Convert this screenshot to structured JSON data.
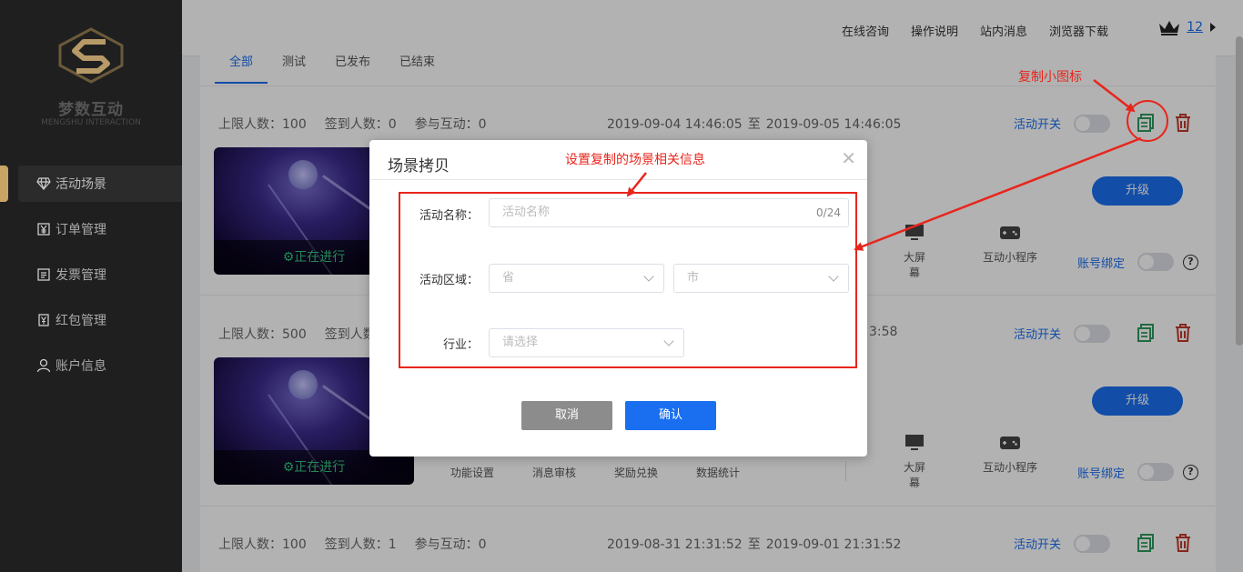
{
  "brand": {
    "name_cn": "梦数互动",
    "name_en": "MENGSHU INTERACTION"
  },
  "sidebar": {
    "items": [
      {
        "label": "活动场景",
        "icon": "diamond-icon",
        "active": true
      },
      {
        "label": "订单管理",
        "icon": "yen-box-icon"
      },
      {
        "label": "发票管理",
        "icon": "invoice-icon"
      },
      {
        "label": "红包管理",
        "icon": "red-envelope-icon"
      },
      {
        "label": "账户信息",
        "icon": "user-icon"
      }
    ]
  },
  "topbar": {
    "links": [
      "在线咨询",
      "操作说明",
      "站内消息",
      "浏览器下载"
    ],
    "vip_count": "12"
  },
  "tabs": [
    "全部",
    "测试",
    "已发布",
    "已结束"
  ],
  "cards": [
    {
      "max_people": "上限人数：100",
      "signed": "签到人数：0",
      "participate": "参与互动：0",
      "start": "2019-09-04 14:46:05",
      "sep": "至",
      "end": "2019-09-05 14:46:05",
      "switch_label": "活动开关",
      "status": "正在进行",
      "upgrade": "升级",
      "big_screen": "大屏幕",
      "mini_program": "互动小程序",
      "bind_label": "账号绑定"
    },
    {
      "max_people": "上限人数：500",
      "signed": "签到人数",
      "end_tail": "3:58",
      "switch_label": "活动开关",
      "status": "正在进行",
      "upgrade": "升级",
      "funcs": [
        "功能设置",
        "消息审核",
        "奖励兑换",
        "数据统计"
      ],
      "big_screen": "大屏幕",
      "mini_program": "互动小程序",
      "bind_label": "账号绑定"
    },
    {
      "max_people": "上限人数：100",
      "signed": "签到人数：1",
      "participate": "参与互动：0",
      "start": "2019-08-31 21:31:52",
      "sep": "至",
      "end": "2019-09-01 21:31:52",
      "switch_label": "活动开关"
    }
  ],
  "modal": {
    "title": "场景拷贝",
    "name_label": "活动名称：",
    "name_placeholder": "活动名称",
    "name_count": "0/24",
    "region_label": "活动区域：",
    "province_placeholder": "省",
    "city_placeholder": "市",
    "industry_label": "行业：",
    "industry_placeholder": "请选择",
    "cancel": "取消",
    "confirm": "确认"
  },
  "annotations": {
    "copy_icon_note": "复制小图标",
    "form_note": "设置复制的场景相关信息",
    "color": "#e8251c"
  },
  "colors": {
    "accent": "#1a6ff0",
    "sidebar_bg": "#1f1f1f",
    "gold": "#c9a467",
    "running": "#35c27a",
    "danger": "#c0392b",
    "copy_green": "#2e9a5d"
  }
}
